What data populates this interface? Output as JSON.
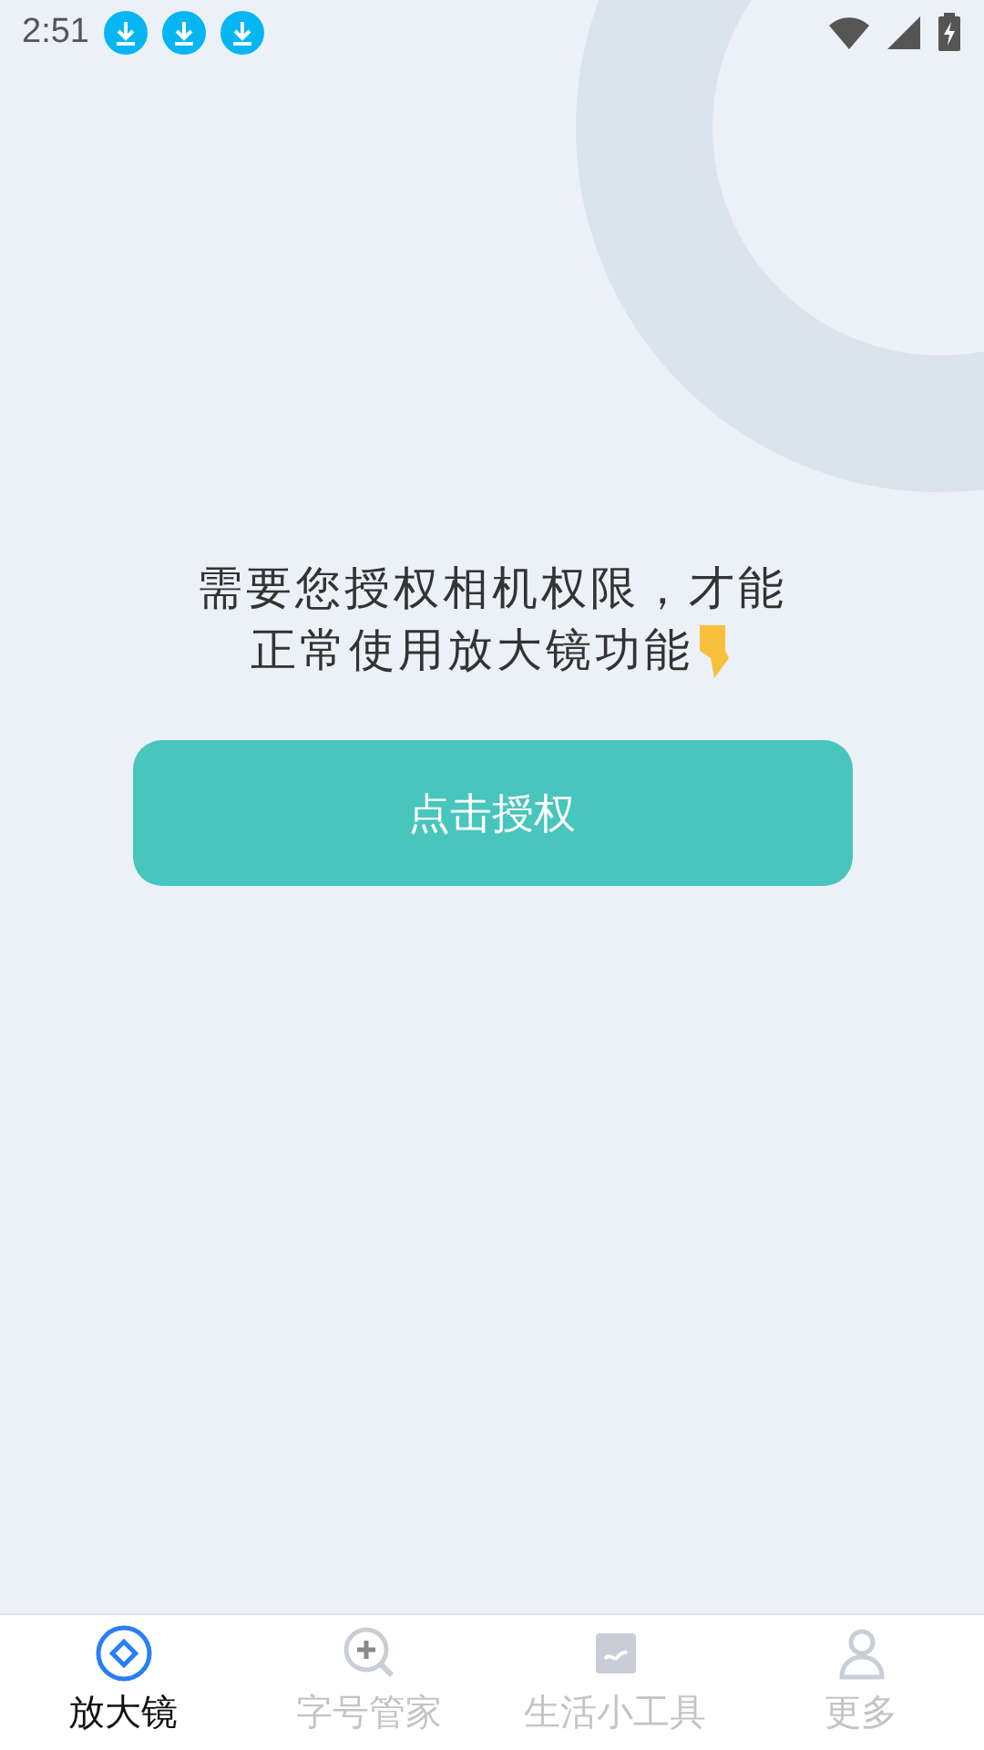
{
  "status_bar": {
    "time": "2:51",
    "notifications": [
      {
        "kind": "download"
      },
      {
        "kind": "download"
      },
      {
        "kind": "download"
      }
    ]
  },
  "prompt": {
    "lines": [
      "需要您授权相机权限，才能",
      "正常使用放大镜功能"
    ]
  },
  "authorize_button": {
    "label": "点击授权"
  },
  "tabs": [
    {
      "label": "放大镜",
      "kind": "magnifier",
      "selected": true
    },
    {
      "label": "字号管家",
      "kind": "zoom",
      "selected": false
    },
    {
      "label": "生活小工具",
      "kind": "tools",
      "selected": false
    },
    {
      "label": "更多",
      "kind": "profile",
      "selected": false
    }
  ]
}
